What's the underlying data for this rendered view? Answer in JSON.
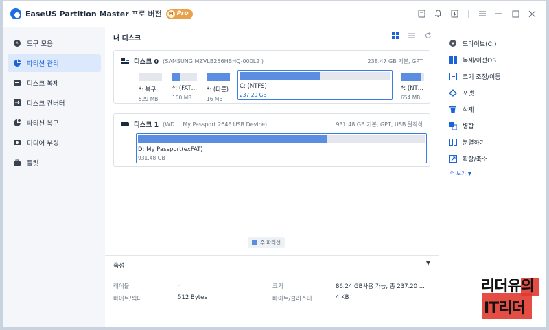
{
  "app": {
    "title": "EaseUS Partition Master",
    "edition": "프로 버전",
    "badge_letter": "M",
    "badge_label": "Pro"
  },
  "sidebar": {
    "items": [
      {
        "label": "도구 모음",
        "icon": "compass-icon",
        "active": false
      },
      {
        "label": "파티션 관리",
        "icon": "pie-chart-icon",
        "active": true
      },
      {
        "label": "디스크 복제",
        "icon": "disk-clone-icon",
        "active": false
      },
      {
        "label": "디스크 컨버터",
        "icon": "disk-convert-icon",
        "active": false
      },
      {
        "label": "파티션 복구",
        "icon": "partition-recovery-icon",
        "active": false
      },
      {
        "label": "미디어 부팅",
        "icon": "media-boot-icon",
        "active": false
      },
      {
        "label": "툴킷",
        "icon": "toolbox-icon",
        "active": false
      }
    ]
  },
  "main": {
    "header": "내 디스크",
    "legend": "주 파티션",
    "disks": [
      {
        "name": "디스크 0",
        "model": "(SAMSUNG MZVLB256HBHQ-000L2 )",
        "info": "238.47 GB 기본, GPT",
        "partitions": [
          {
            "name": "*: 복구…",
            "size": "529 MB",
            "fill": 0.0
          },
          {
            "name": "*: (FAT…",
            "size": "100 MB",
            "fill": 0.3
          },
          {
            "name": "*: (다른)",
            "size": "16 MB",
            "fill": 1.0
          },
          {
            "name": "C: (NTFS)",
            "size": "237.20 GB",
            "fill": 0.53,
            "selected": true
          },
          {
            "name": "*: (NT…",
            "size": "654 MB",
            "fill": 0.85
          }
        ]
      },
      {
        "name": "디스크 1",
        "model_prefix": "(WD",
        "model": "My Passport 264F USB Device)",
        "info": "931.48 GB 기본, GPT, USB 탈착식",
        "partitions": [
          {
            "name": "D: My Passport(exFAT)",
            "size": "931.48 GB",
            "fill": 0.66,
            "selected": true
          }
        ]
      }
    ],
    "properties": {
      "title": "속성",
      "rows": [
        {
          "label": "레이블",
          "value": "-"
        },
        {
          "label": "바이트/섹터",
          "value": "512 Bytes"
        },
        {
          "label": "크기",
          "value": "86.24 GB사용 가능, 총 237.20 ..."
        },
        {
          "label": "바이트/클러스터",
          "value": "4 KB"
        }
      ]
    }
  },
  "right_panel": {
    "items": [
      {
        "label": "드라이브(C:)",
        "icon": "drive-icon"
      },
      {
        "label": "복제/이전OS",
        "icon": "windows-icon"
      },
      {
        "label": "크기 조정/이동",
        "icon": "resize-icon"
      },
      {
        "label": "포맷",
        "icon": "format-icon"
      },
      {
        "label": "삭제",
        "icon": "trash-icon"
      },
      {
        "label": "병합",
        "icon": "merge-icon"
      },
      {
        "label": "분열하기",
        "icon": "split-icon"
      },
      {
        "label": "확장/축소",
        "icon": "expand-icon"
      }
    ],
    "more": "더 보기 ▼"
  },
  "watermark": {
    "line1": "리더유의",
    "line2": "IT리더"
  }
}
